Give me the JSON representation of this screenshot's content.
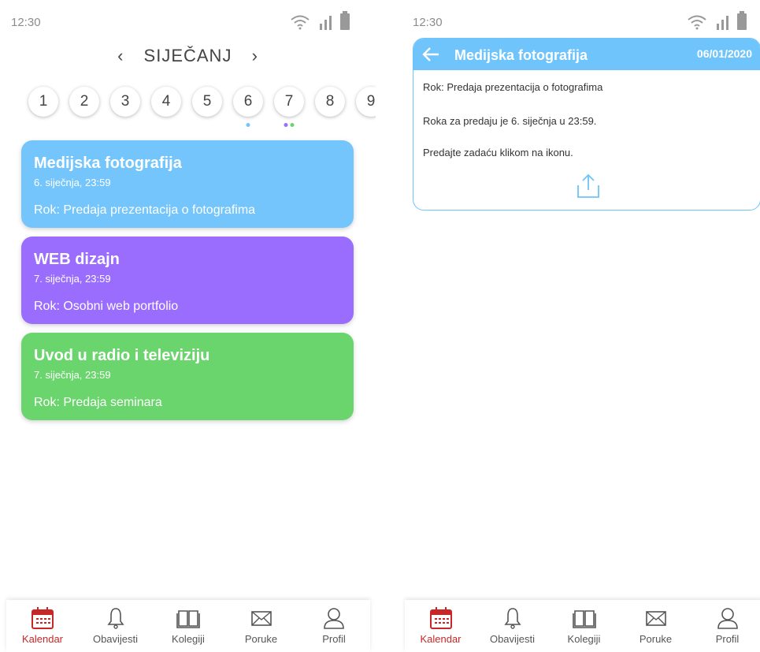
{
  "colors": {
    "accent_red": "#c62828",
    "light_blue": "#6ec4fb",
    "purple": "#9a6dff",
    "green": "#6ad56c"
  },
  "status_bar": {
    "time": "12:30",
    "icons": [
      "wifi-icon",
      "signal-icon",
      "battery-icon"
    ]
  },
  "calendar": {
    "month": "SIJEČANJ",
    "prev_arrow": "‹",
    "next_arrow": "›",
    "days": [
      "1",
      "2",
      "3",
      "4",
      "5",
      "6",
      "7",
      "8",
      "9"
    ],
    "events": [
      {
        "title": "Medijska fotografija",
        "date": "6. siječnja, 23:59",
        "task": "Rok: Predaja prezentacija o fotografima",
        "color": "#74c5fb"
      },
      {
        "title": "WEB dizajn",
        "date": "7. siječnja, 23:59",
        "task": "Rok: Osobni web portfolio",
        "color": "#9a6dff"
      },
      {
        "title": "Uvod u radio i televiziju",
        "date": "7. siječnja, 23:59",
        "task": "Rok: Predaja seminara",
        "color": "#6ad56c"
      }
    ]
  },
  "detail": {
    "title": "Medijska fotografija",
    "date": "06/01/2020",
    "lines": [
      "Rok: Predaja prezentacija o fotografima",
      "Roka za predaju je 6. siječnja u 23:59.",
      "Predajte zadaću klikom na ikonu."
    ]
  },
  "bottom_nav": [
    {
      "label": "Kalendar",
      "icon": "calendar-icon",
      "active": true
    },
    {
      "label": "Obavijesti",
      "icon": "bell-icon",
      "active": false
    },
    {
      "label": "Kolegiji",
      "icon": "book-icon",
      "active": false
    },
    {
      "label": "Poruke",
      "icon": "envelope-icon",
      "active": false
    },
    {
      "label": "Profil",
      "icon": "user-icon",
      "active": false
    }
  ]
}
